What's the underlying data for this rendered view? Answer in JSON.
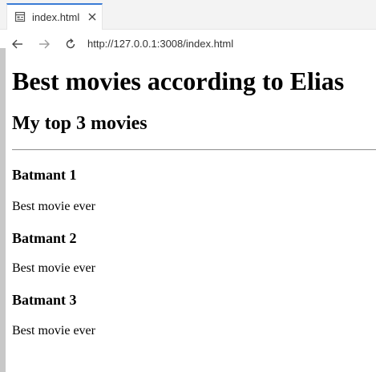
{
  "browser": {
    "tab": {
      "title": "index.html"
    },
    "address": {
      "url": "http://127.0.0.1:3008/index.html"
    },
    "icons": {
      "tab": "page-icon",
      "close": "close-icon",
      "back": "arrow-left-icon",
      "forward": "arrow-right-icon",
      "reload": "reload-icon"
    },
    "accent_color": "#3a7bd5"
  },
  "page": {
    "heading": "Best movies according to Elias",
    "subheading": "My top 3 movies",
    "movies": [
      {
        "title": "Batmant 1",
        "description": "Best movie ever"
      },
      {
        "title": "Batmant 2",
        "description": "Best movie ever"
      },
      {
        "title": "Batmant 3",
        "description": "Best movie ever"
      }
    ]
  }
}
